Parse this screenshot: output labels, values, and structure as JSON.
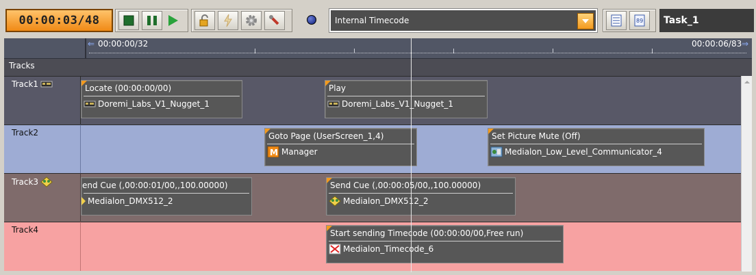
{
  "toolbar": {
    "timecode": "00:00:03/48",
    "source_select": "Internal Timecode",
    "task_name": "Task_1"
  },
  "ruler": {
    "start_label": "00:00:00/32",
    "end_label": "00:00:06/83"
  },
  "tracks_header": "Tracks",
  "tracks": [
    {
      "name": "Track1",
      "color": "#585867"
    },
    {
      "name": "Track2",
      "color": "#9eacd4"
    },
    {
      "name": "Track3",
      "color": "#7f6b6b"
    },
    {
      "name": "Track4",
      "color": "#f7a2a2"
    }
  ],
  "cues": [
    {
      "title": "Locate (00:00:00/00)",
      "device": "Doremi_Labs_V1_Nugget_1"
    },
    {
      "title": "Play",
      "device": "Doremi_Labs_V1_Nugget_1"
    },
    {
      "title": "Goto Page (UserScreen_1,4)",
      "device": "Manager"
    },
    {
      "title": "Set Picture Mute (Off)",
      "device": "Medialon_Low_Level_Communicator_4"
    },
    {
      "title": "end Cue (,00:00:01/00,,100.00000)",
      "device": "Medialon_DMX512_2"
    },
    {
      "title": "Send Cue (,00:00:05/00,,100.00000)",
      "device": "Medialon_DMX512_2"
    },
    {
      "title": "Start sending Timecode (00:00:00/00,Free run)",
      "device": "Medialon_Timecode_6"
    }
  ],
  "icons": {
    "stop": "stop-icon",
    "pause": "pause-icon",
    "play": "play-icon",
    "lock": "lock-icon",
    "lightning": "lightning-icon",
    "gear": "gear-icon",
    "wrench": "wrench-icon",
    "record": "record-dot-icon",
    "list_view": "list-view-icon",
    "sort": "sort-icon"
  }
}
